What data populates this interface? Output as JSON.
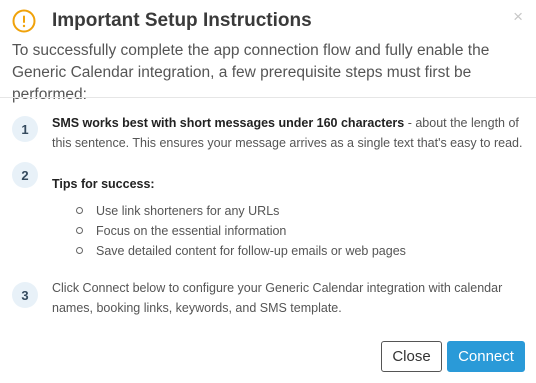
{
  "dialog": {
    "title": "Important Setup Instructions",
    "close_glyph": "×",
    "intro": "To successfully complete the app connection flow and fully enable the Generic Calendar integration, a few prerequisite steps must first be performed:",
    "icon_color": "#f0a20a",
    "accent_color": "#2a9ad8"
  },
  "steps": [
    {
      "number": "1",
      "bold_text": "SMS works best with short messages under 160 characters",
      "text": " - about the length of this sentence. This ensures your message arrives as a single text that's easy to read."
    },
    {
      "number": "2",
      "title": "Tips for success:",
      "tips": [
        "Use link shorteners for any URLs",
        "Focus on the essential information",
        "Save detailed content for follow-up emails or web pages"
      ]
    },
    {
      "number": "3",
      "text": "Click Connect below to configure your Generic Calendar integration with calendar names, booking links, keywords, and SMS template."
    }
  ],
  "buttons": {
    "close_label": "Close",
    "connect_label": "Connect"
  }
}
